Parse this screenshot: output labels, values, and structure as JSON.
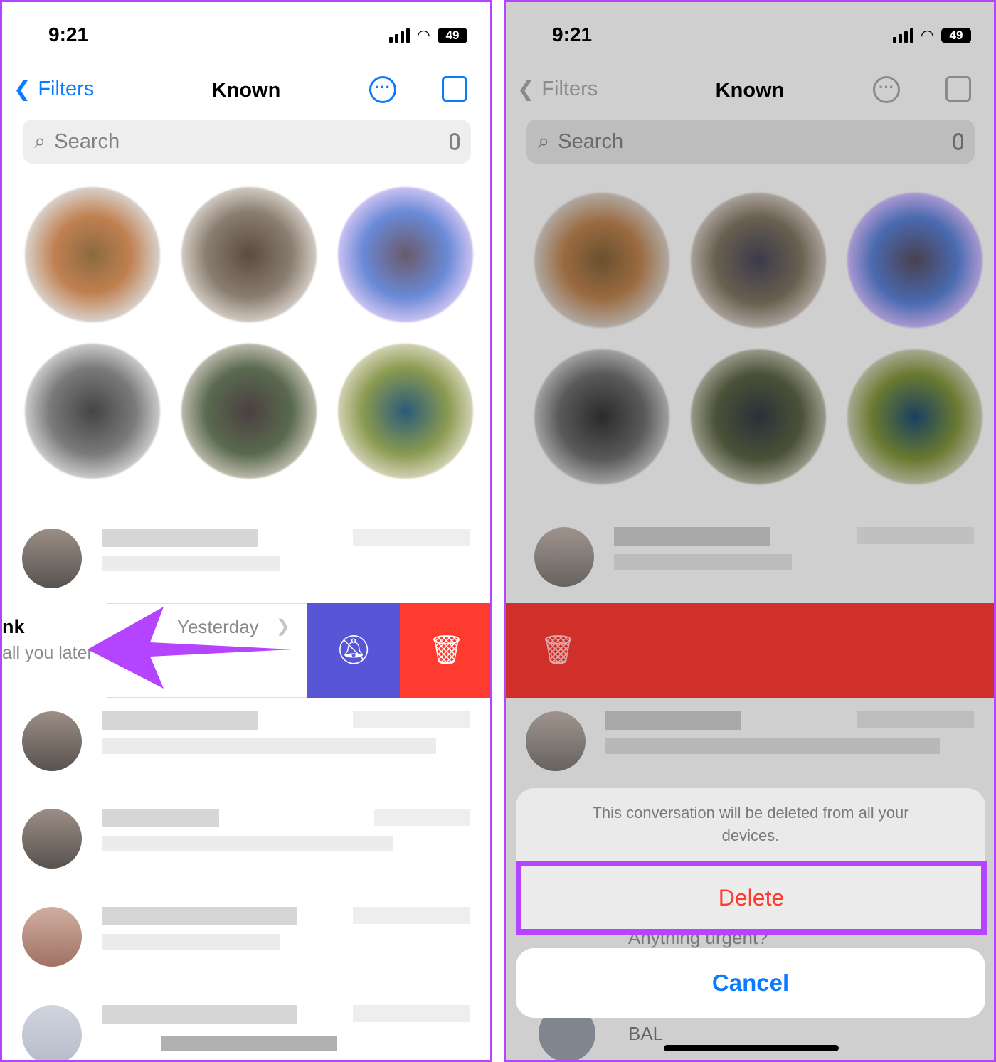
{
  "status": {
    "time": "9:21",
    "battery": "49"
  },
  "nav": {
    "back_label": "Filters",
    "title": "Known"
  },
  "search": {
    "placeholder": "Search"
  },
  "swiped_row": {
    "name_fragment": "nk",
    "preview_fragment": "all you later",
    "date": "Yesterday"
  },
  "actions": {
    "mute_icon": "bell-slash-icon",
    "delete_icon": "trash-icon",
    "mute_color": "#5856d6",
    "delete_color": "#ff3b30"
  },
  "sheet": {
    "message": "This conversation will be deleted from all your devices.",
    "delete_label": "Delete",
    "cancel_label": "Cancel"
  },
  "background_rows": [
    {
      "preview": "Anything urgent?"
    },
    {
      "preview": "BAL"
    }
  ],
  "annotation_color": "#b444ff"
}
